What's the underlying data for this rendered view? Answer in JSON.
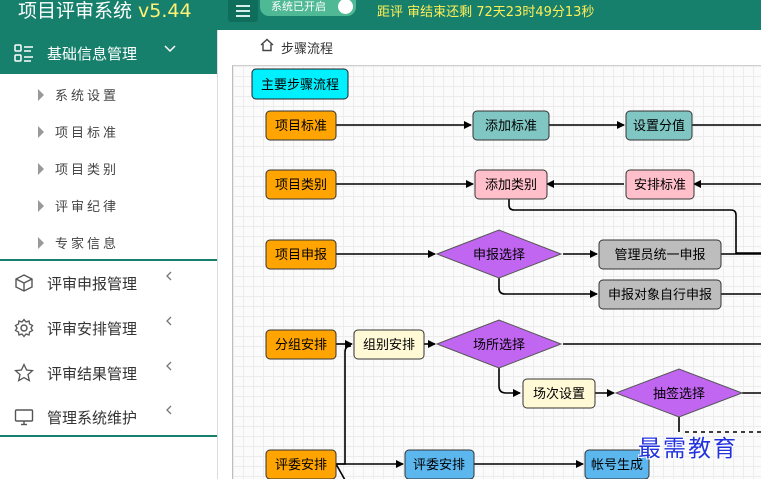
{
  "header": {
    "title": "项目评审系统",
    "version": "v5.44",
    "system_status": "系统已开启",
    "countdown": "距评 审结束还剩 72天23时49分13秒"
  },
  "sidebar": {
    "sections": [
      {
        "label": "基础信息管理",
        "icon": "list-icon",
        "expanded": true,
        "items": [
          "系统设置",
          "项目标准",
          "项目类别",
          "评审纪律",
          "专家信息"
        ]
      },
      {
        "label": "评审申报管理",
        "icon": "box-icon"
      },
      {
        "label": "评审安排管理",
        "icon": "gear-icon"
      },
      {
        "label": "评审结果管理",
        "icon": "star-icon"
      },
      {
        "label": "管理系统维护",
        "icon": "monitor-icon"
      }
    ]
  },
  "breadcrumb": "步骤流程",
  "flow": {
    "title": "主要步骤流程",
    "nodes": {
      "xmbz": "项目标准",
      "tjbz": "添加标准",
      "szfz": "设置分值",
      "xmlb": "项目类别",
      "tjlb": "添加类别",
      "apbz": "安排标准",
      "xmsb": "项目申报",
      "sbxz": "申报选择",
      "glytysb": "管理员统一申报",
      "sbdxzxsb": "申报对象自行申报",
      "fzap": "分组安排",
      "zbap": "组别安排",
      "csxz": "场所选择",
      "ccsz": "场次设置",
      "cqxz": "抽签选择",
      "pwap": "评委安排",
      "pwap2": "评委安排",
      "zhsc": "帐号生成"
    },
    "colors": {
      "orange": "#ffa400",
      "teal": "#80c7c3",
      "pink": "#ffc0cb",
      "purple": "#c166f0",
      "gray": "#bdbdbd",
      "cream": "#fff9d6",
      "blue": "#5db7ef",
      "cyan": "#00f0ff"
    }
  },
  "watermark": "最需教育"
}
